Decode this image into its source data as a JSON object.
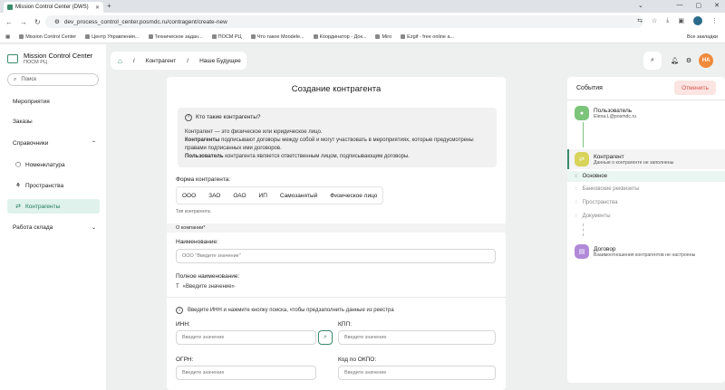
{
  "browser": {
    "tab_title": "Mission Control Center (DWS)",
    "url": "dev_process_control_center.posmdc.ru/contragent/create-new",
    "bookmarks": [
      "Mission Control Center",
      "Центр Управления...",
      "Техническое задан...",
      "ПОСМ РЦ",
      "Что такое Moodele...",
      "Координатор - Док...",
      "Miro",
      "Ezgif - free online a..."
    ],
    "all_bookmarks": "Все закладки"
  },
  "app": {
    "brand_title": "Mission Control Center",
    "brand_sub": "ПОСМ РЦ",
    "search_placeholder": "Поиск",
    "nav": {
      "events": "Мероприятия",
      "orders": "Заказы",
      "refs": "Справочники",
      "nomenclature": "Номенклатура",
      "spaces": "Пространства",
      "contragents": "Контрагенты",
      "warehouse": "Работа склада"
    },
    "breadcrumb": {
      "item1": "Контрагент",
      "item2": "Наше Будущее"
    },
    "avatar": "НА"
  },
  "form": {
    "title": "Создание контрагента",
    "info_title": "Кто такие контрагенты?",
    "info_line1": "Контрагент — это физическое или юридическое лицо.",
    "info_line2_bold": "Контрагенты",
    "info_line2": " подписывают договоры между собой и могут участвовать в мероприятиях, которые предусмотрены",
    "info_line3": "правами подписанных ими договоров.",
    "info_line4_bold": "Пользователь",
    "info_line4": " контрагента является ответственным лицом, подписывающим договоры.",
    "form_label": "Форма контрагента:",
    "types": [
      "ООО",
      "ЗАО",
      "ОАО",
      "ИП",
      "Самозанятый",
      "Физическое лицо"
    ],
    "type_hint": "Тип контрагента.",
    "section_company": "О компании*",
    "name_label": "Наименование:",
    "name_placeholder": "ООО \"Введите значение\"",
    "fullname_label": "Полное наименование:",
    "fullname_value": "«Введите значение»",
    "inn_note": "Введите ИНН и нажмите кнопку поиска, чтобы предзаполнить данные из реестра",
    "inn_label": "ИНН:",
    "kpp_label": "КПП:",
    "ogrn_label": "ОГРН:",
    "okpo_label": "Код по ОКПО:",
    "placeholder": "Введите значение"
  },
  "events": {
    "title": "События",
    "cancel": "Отменить",
    "user_title": "Пользователь",
    "user_sub": "Elena.L@posmdc.ru",
    "contragent_title": "Контрагент",
    "contragent_sub": "Данные о контрагенте не заполнены",
    "sub_items": [
      "Основное",
      "Банковские реквизиты",
      "Пространства",
      "Документы"
    ],
    "contract_title": "Договор",
    "contract_sub": "Взаимоотношения контрагентов не настроены"
  },
  "colors": {
    "accent": "#3a8a6a",
    "cancel": "#d9534f",
    "avatar": "#f08a3c"
  }
}
